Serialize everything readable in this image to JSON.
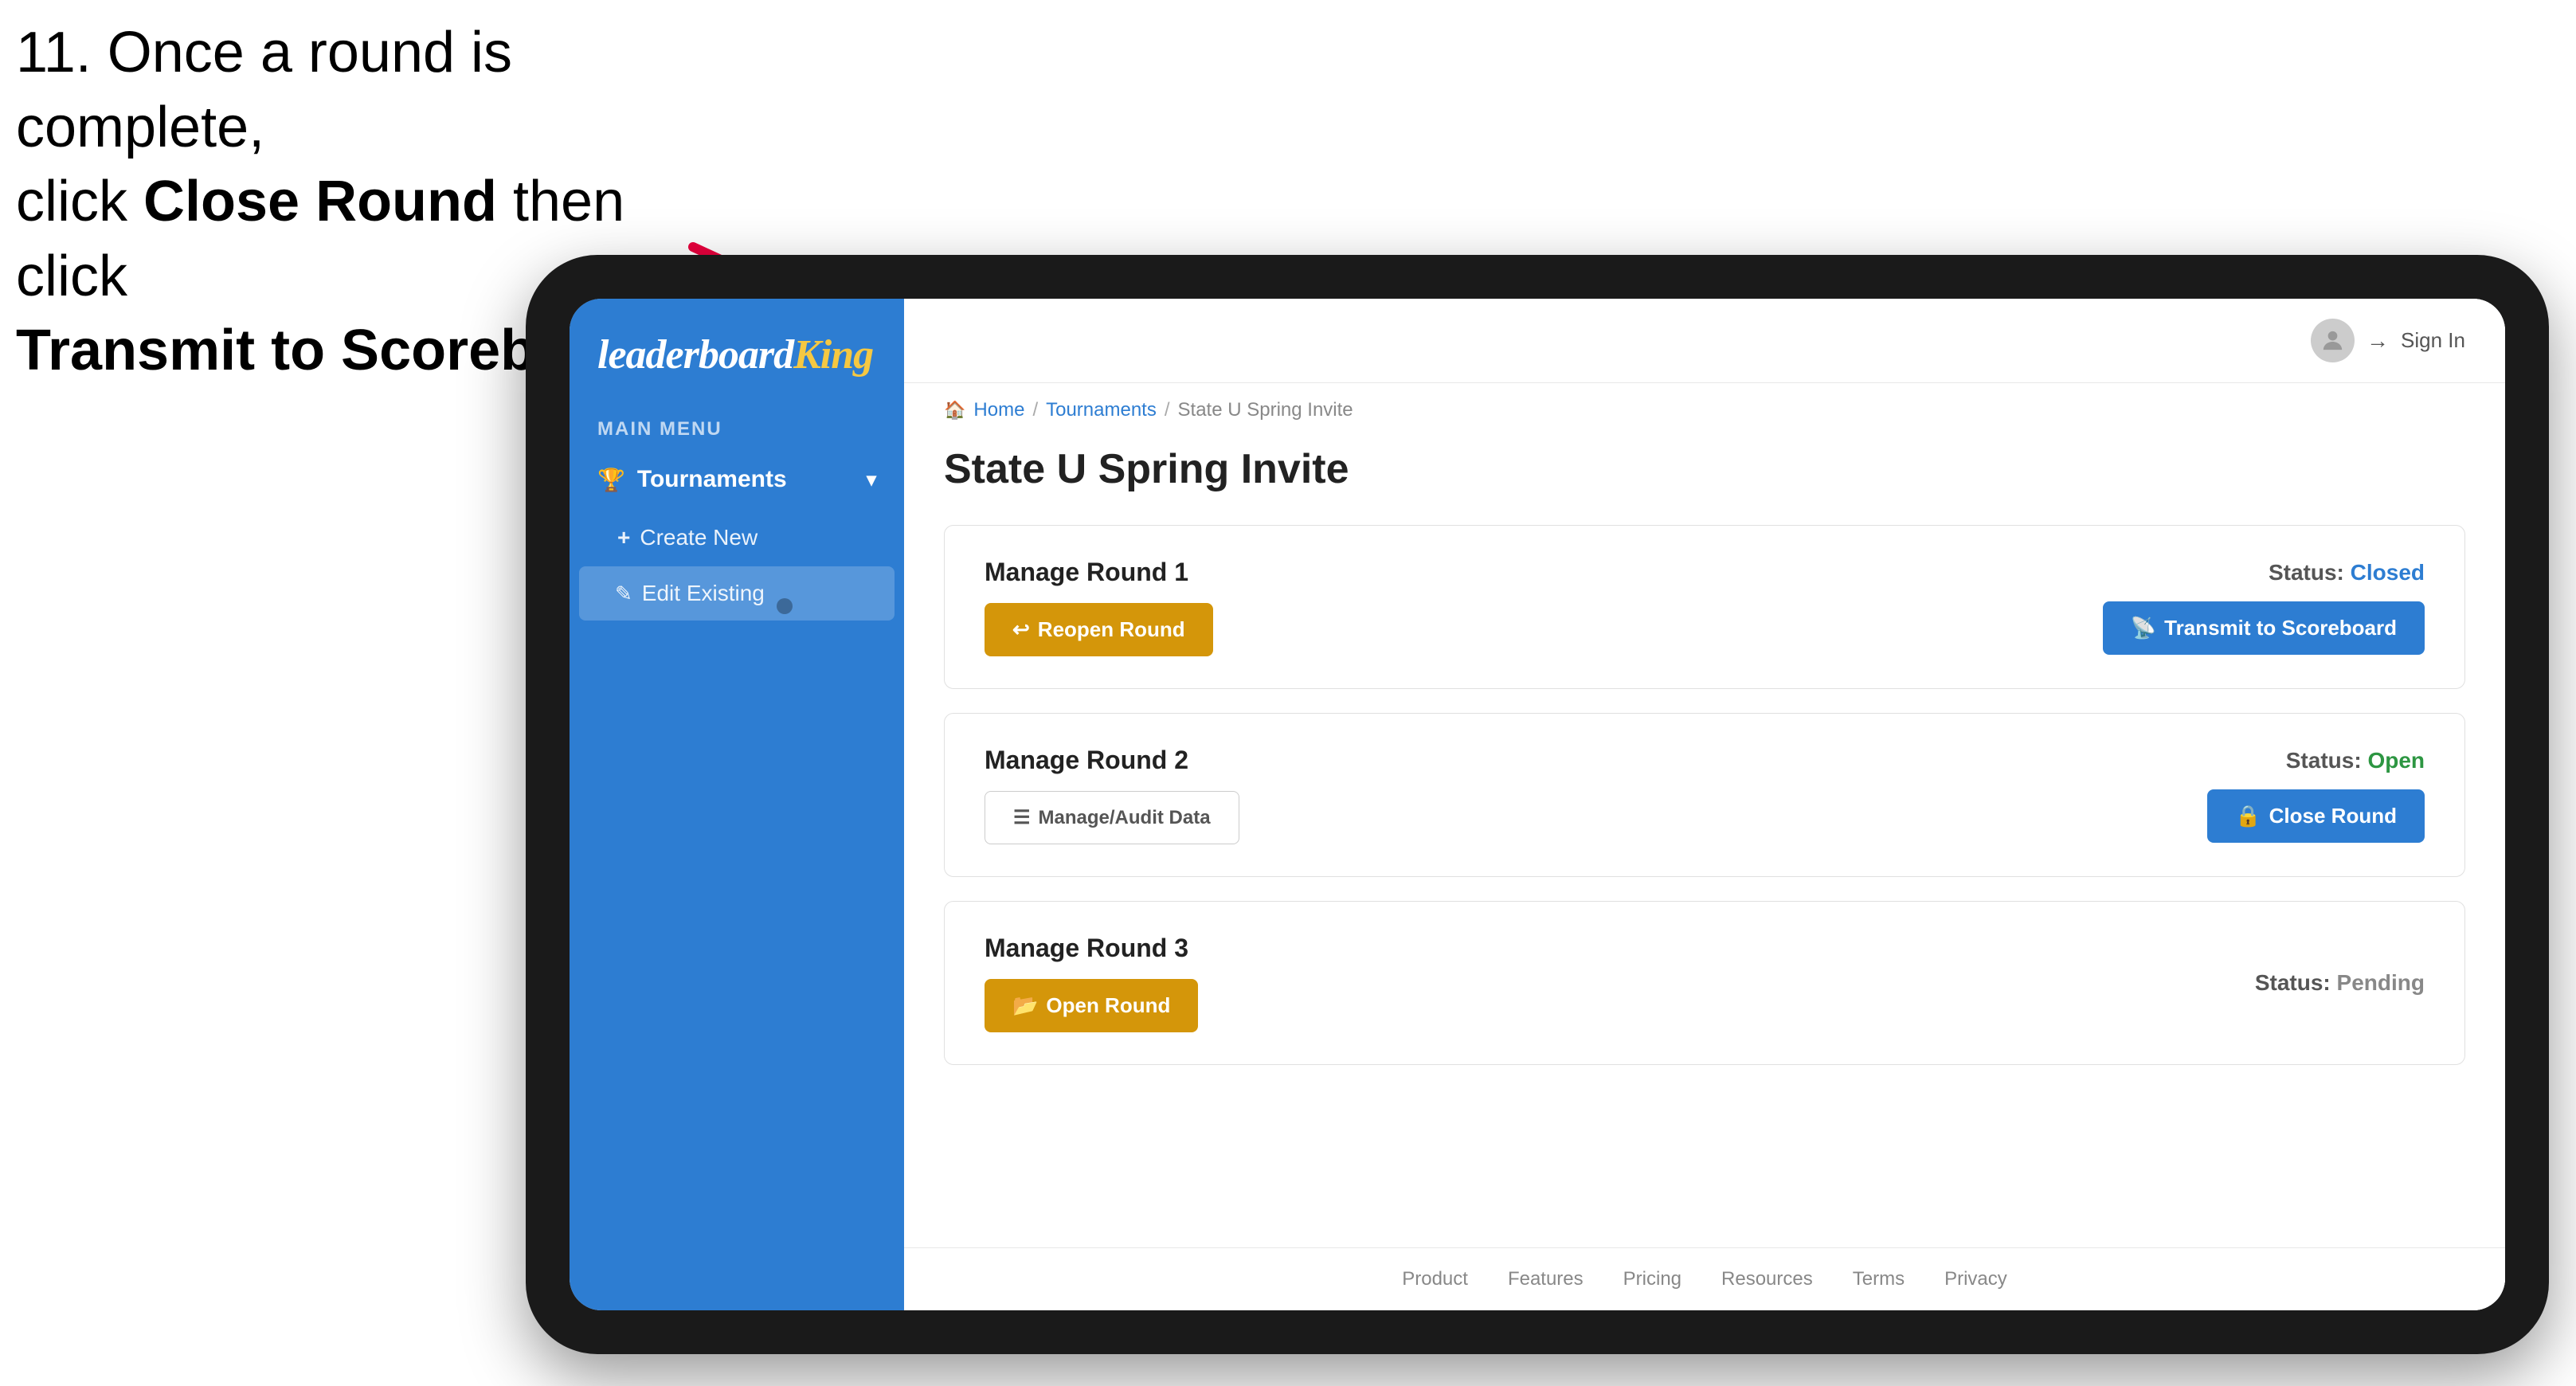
{
  "instruction": {
    "line1": "11. Once a round is complete,",
    "line2_pre": "click ",
    "line2_bold": "Close Round",
    "line2_post": " then click",
    "line3": "Transmit to Scoreboard."
  },
  "breadcrumb": {
    "home": "Home",
    "tournaments": "Tournaments",
    "current": "State U Spring Invite"
  },
  "sidebar": {
    "logo_text": "leaderboard",
    "logo_king": "King",
    "main_menu_label": "MAIN MENU",
    "items": [
      {
        "label": "Tournaments",
        "icon": "trophy"
      }
    ],
    "sub_items": [
      {
        "label": "Create New",
        "icon": "plus"
      },
      {
        "label": "Edit Existing",
        "icon": "edit",
        "active": true
      }
    ]
  },
  "header": {
    "sign_in_label": "Sign In"
  },
  "page": {
    "title": "State U Spring Invite",
    "rounds": [
      {
        "id": "round1",
        "title": "Manage Round 1",
        "status_label": "Status:",
        "status_value": "Closed",
        "status_class": "status-closed",
        "buttons": [
          {
            "label": "Reopen Round",
            "style": "gold",
            "icon": "reopen"
          },
          {
            "label": "Transmit to Scoreboard",
            "style": "blue",
            "icon": "transmit"
          }
        ]
      },
      {
        "id": "round2",
        "title": "Manage Round 2",
        "status_label": "Status:",
        "status_value": "Open",
        "status_class": "status-open",
        "buttons": [
          {
            "label": "Manage/Audit Data",
            "style": "outline",
            "icon": "audit"
          },
          {
            "label": "Close Round",
            "style": "blue",
            "icon": "close"
          }
        ]
      },
      {
        "id": "round3",
        "title": "Manage Round 3",
        "status_label": "Status:",
        "status_value": "Pending",
        "status_class": "status-pending",
        "buttons": [
          {
            "label": "Open Round",
            "style": "gold",
            "icon": "open"
          }
        ]
      }
    ]
  },
  "footer": {
    "links": [
      "Product",
      "Features",
      "Pricing",
      "Resources",
      "Terms",
      "Privacy"
    ]
  }
}
